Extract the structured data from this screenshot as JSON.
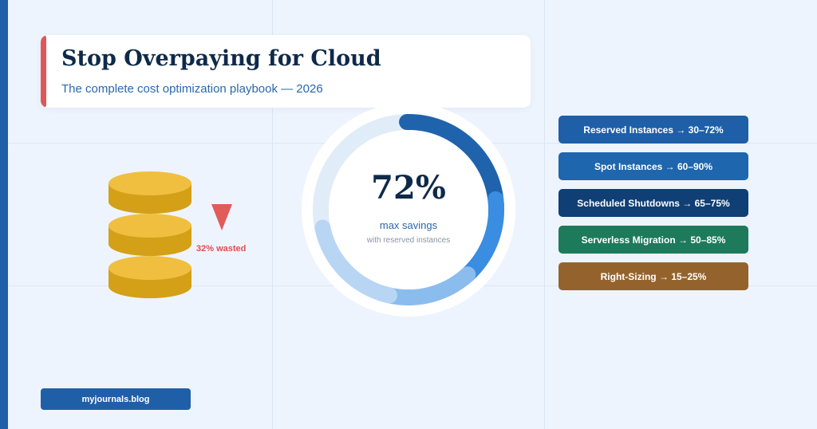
{
  "header": {
    "title": "Stop Overpaying for Cloud",
    "subtitle": "The complete cost optimization playbook — 2026"
  },
  "waste": {
    "label": "32% wasted"
  },
  "savings": {
    "value": 72,
    "percent_label": "72%",
    "label": "max savings",
    "sublabel": "with reserved instances"
  },
  "strategies": [
    {
      "label": "Reserved Instances → 30–72%",
      "color": "#1f5fa8"
    },
    {
      "label": "Spot Instances → 60–90%",
      "color": "#1e66ad"
    },
    {
      "label": "Scheduled Shutdowns → 65–75%",
      "color": "#0f3f75"
    },
    {
      "label": "Serverless Migration → 50–85%",
      "color": "#1d7a5a"
    },
    {
      "label": "Right-Sizing → 15–25%",
      "color": "#94632d"
    }
  ],
  "footer": {
    "site": "myjournals.blog"
  },
  "colors": {
    "accent": "#e05656",
    "brand": "#1f5fa8",
    "coin": "#e0ac2c",
    "background": "#eef4fd"
  }
}
